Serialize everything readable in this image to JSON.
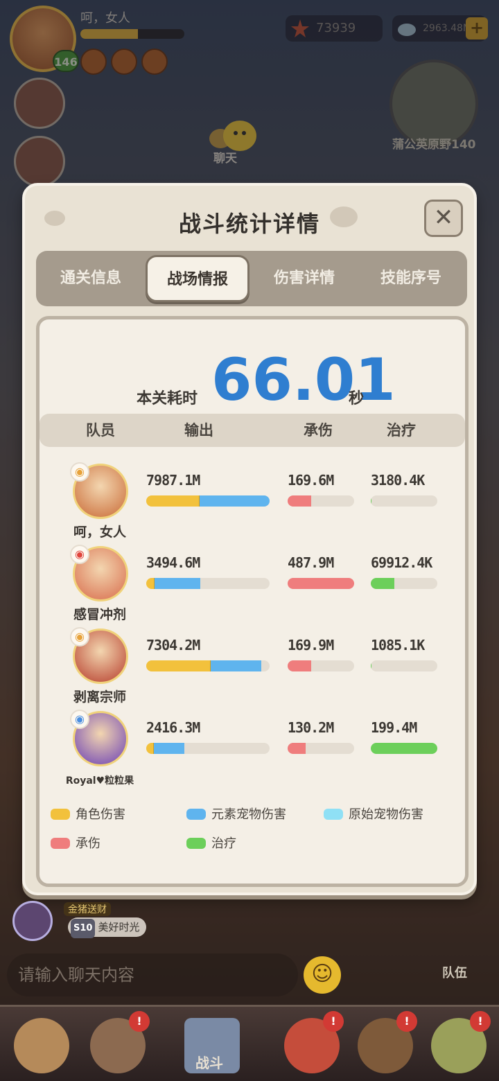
{
  "hud": {
    "player_name": "呵，女人",
    "level": "146",
    "exp_fraction": 0.55,
    "currency_1": "73939",
    "currency_2": "2963.48M",
    "map_name": "蒲公英原野140",
    "chat_label": "聊天"
  },
  "dialog": {
    "title": "战斗统计详情",
    "close_symbol": "✕",
    "tabs": [
      {
        "label": "通关信息",
        "active": false
      },
      {
        "label": "战场情报",
        "active": true
      },
      {
        "label": "伤害详情",
        "active": false
      },
      {
        "label": "技能序号",
        "active": false
      }
    ],
    "time_label": "本关耗时",
    "time_value": "66.01",
    "time_unit": "秒",
    "headers": {
      "member": "队员",
      "output": "输出",
      "taken": "承伤",
      "heal": "治疗"
    },
    "players": [
      {
        "name": "呵，女人",
        "output": "7987.1M",
        "output_yellow": 0.43,
        "output_blue": 0.57,
        "taken": "169.6M",
        "taken_frac": 0.35,
        "heal": "3180.4K",
        "heal_frac": 0.01,
        "avatar_color": "#c96a36",
        "element_color": "#e7a23a"
      },
      {
        "name": "感冒冲剂",
        "output": "3494.6M",
        "output_yellow": 0.07,
        "output_blue": 0.37,
        "taken": "487.9M",
        "taken_frac": 1.0,
        "heal": "69912.4K",
        "heal_frac": 0.35,
        "avatar_color": "#d86c4c",
        "element_color": "#e0443c"
      },
      {
        "name": "剥离宗师",
        "output": "7304.2M",
        "output_yellow": 0.52,
        "output_blue": 0.41,
        "taken": "169.9M",
        "taken_frac": 0.35,
        "heal": "1085.1K",
        "heal_frac": 0.01,
        "avatar_color": "#b63d2c",
        "element_color": "#e7a23a"
      },
      {
        "name": "Royal♥粒粒果",
        "output": "2416.3M",
        "output_yellow": 0.06,
        "output_blue": 0.25,
        "taken": "130.2M",
        "taken_frac": 0.27,
        "heal": "199.4M",
        "heal_frac": 1.0,
        "avatar_color": "#6a3fb5",
        "element_color": "#4a8ee0"
      }
    ],
    "legend": [
      {
        "label": "角色伤害",
        "color": "#f2c13c"
      },
      {
        "label": "元素宠物伤害",
        "color": "#5fb4ee"
      },
      {
        "label": "原始宠物伤害",
        "color": "#8fe0f5"
      },
      {
        "label": "承伤",
        "color": "#ef7d7d"
      },
      {
        "label": "治疗",
        "color": "#6ccf5a"
      }
    ]
  },
  "bottom": {
    "news_tag": "金猪送财",
    "news_rank": "S10",
    "news_text": "美好时光",
    "chat_placeholder": "请输入聊天内容",
    "team_label": "队伍",
    "battle_label": "战斗"
  }
}
